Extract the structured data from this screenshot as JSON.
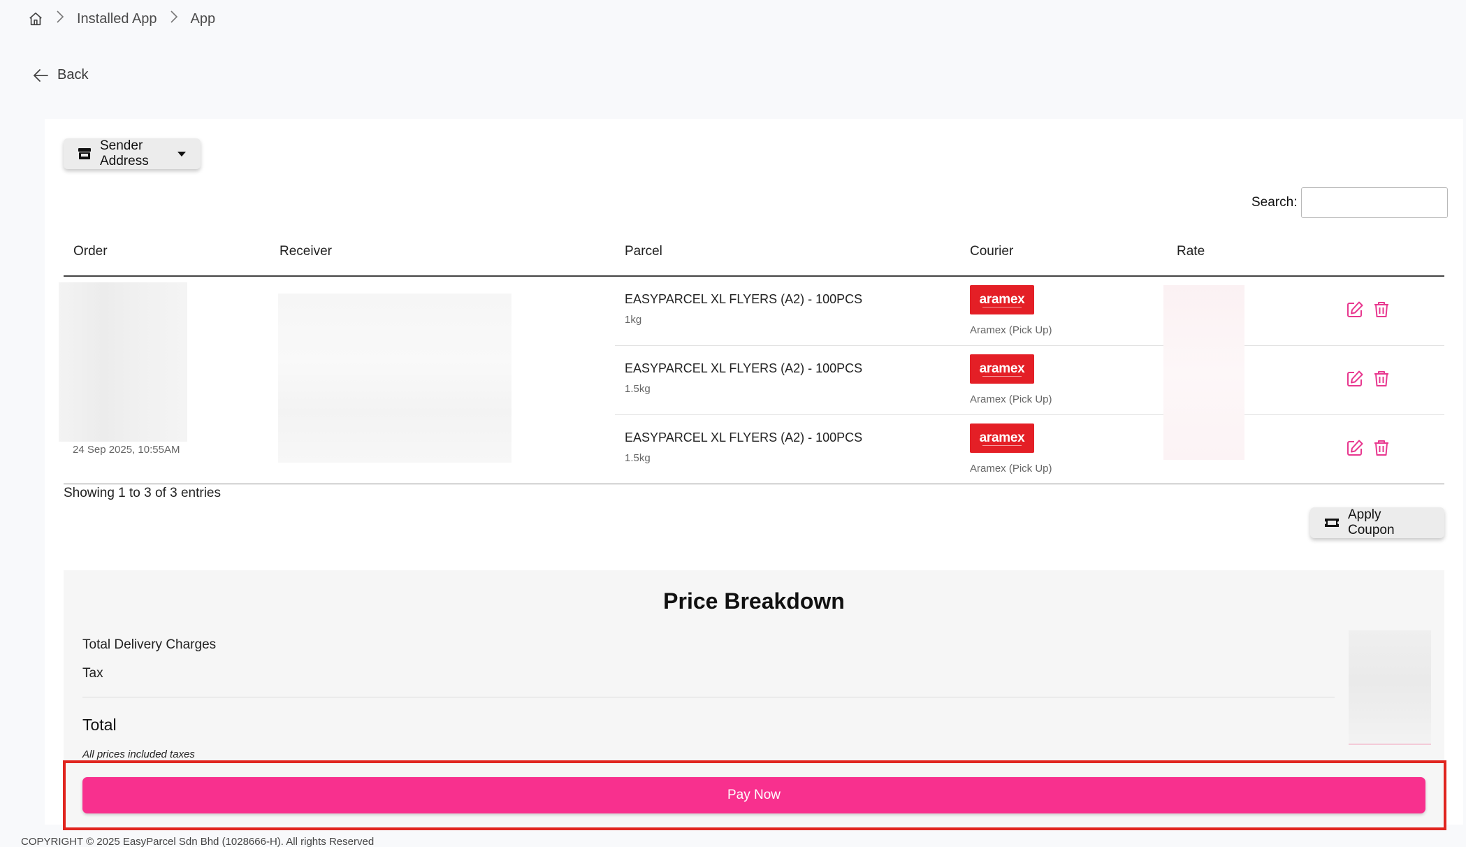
{
  "breadcrumb": {
    "items": [
      "Installed App",
      "App"
    ]
  },
  "back_label": "Back",
  "sender_address_label": "Sender Address",
  "search": {
    "label": "Search:",
    "value": "",
    "placeholder": ""
  },
  "table": {
    "headers": {
      "order": "Order",
      "receiver": "Receiver",
      "parcel": "Parcel",
      "courier": "Courier",
      "rate": "Rate"
    },
    "order_date": "24 Sep 2025, 10:55AM",
    "rows": [
      {
        "parcel_name": "EASYPARCEL XL FLYERS (A2) - 100PCS",
        "weight": "1kg",
        "courier_logo": "aramex",
        "courier_service": "Aramex (Pick Up)"
      },
      {
        "parcel_name": "EASYPARCEL XL FLYERS (A2) - 100PCS",
        "weight": "1.5kg",
        "courier_logo": "aramex",
        "courier_service": "Aramex (Pick Up)"
      },
      {
        "parcel_name": "EASYPARCEL XL FLYERS (A2) - 100PCS",
        "weight": "1.5kg",
        "courier_logo": "aramex",
        "courier_service": "Aramex (Pick Up)"
      }
    ]
  },
  "showing_text": "Showing 1 to 3 of 3 entries",
  "apply_coupon_label": "Apply Coupon",
  "price_breakdown": {
    "title": "Price Breakdown",
    "total_delivery_label": "Total Delivery Charges",
    "tax_label": "Tax",
    "total_label": "Total",
    "note": "All prices included taxes"
  },
  "pay_now_label": "Pay Now",
  "footer_text": "COPYRIGHT © 2025 EasyParcel Sdn Bhd (1028666-H). All rights Reserved",
  "colors": {
    "accent_pink": "#f8308e",
    "aramex_red": "#e41f26",
    "highlight_red": "#e0251f"
  },
  "icons": {
    "home": "home-icon",
    "chevron": "chevron-right-icon",
    "back": "arrow-left-icon",
    "store": "store-icon",
    "caret": "caret-down-icon",
    "edit": "edit-icon",
    "delete": "trash-icon",
    "coupon": "ticket-icon"
  }
}
